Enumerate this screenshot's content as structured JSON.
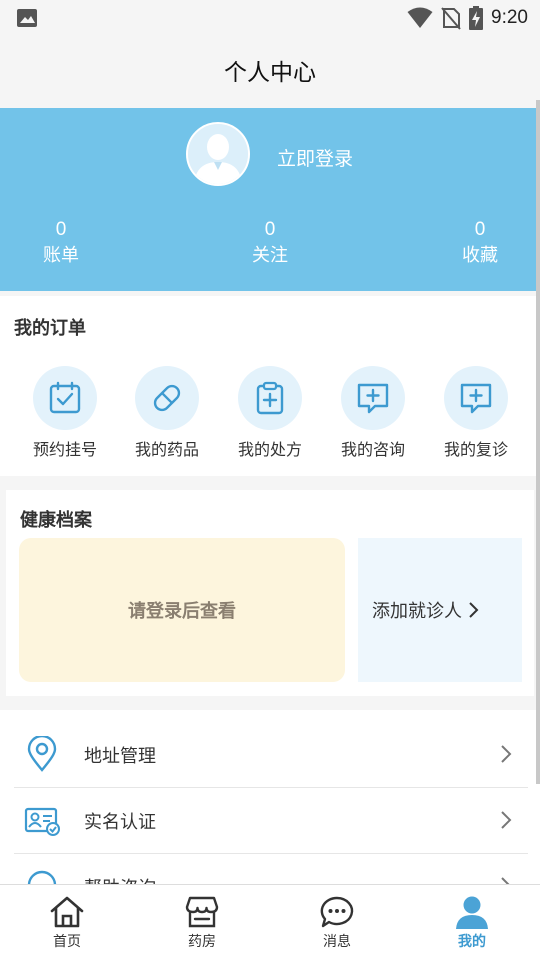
{
  "status_bar": {
    "time": "9:20",
    "icons": [
      "image-icon",
      "wifi-icon",
      "no-sim-icon",
      "battery-charging-icon"
    ]
  },
  "header": {
    "title": "个人中心"
  },
  "profile": {
    "login_label": "立即登录",
    "stats": [
      {
        "value": "0",
        "label": "账单"
      },
      {
        "value": "0",
        "label": "关注"
      },
      {
        "value": "0",
        "label": "收藏"
      }
    ],
    "colors": {
      "background": "#72c3e9"
    }
  },
  "orders": {
    "title": "我的订单",
    "items": [
      {
        "label": "预约挂号",
        "icon": "calendar-check-icon"
      },
      {
        "label": "我的药品",
        "icon": "pill-icon"
      },
      {
        "label": "我的处方",
        "icon": "clipboard-plus-icon"
      },
      {
        "label": "我的咨询",
        "icon": "chat-plus-icon"
      },
      {
        "label": "我的复诊",
        "icon": "chat-plus-icon"
      }
    ]
  },
  "health": {
    "title": "健康档案",
    "login_prompt": "请登录后查看",
    "add_patient": "添加就诊人"
  },
  "menu": {
    "items": [
      {
        "label": "地址管理",
        "icon": "location-pin-icon"
      },
      {
        "label": "实名认证",
        "icon": "id-card-icon"
      },
      {
        "label": "帮助咨询",
        "icon": "headset-icon"
      }
    ]
  },
  "tabbar": {
    "tabs": [
      {
        "label": "首页",
        "icon": "home-icon"
      },
      {
        "label": "药房",
        "icon": "store-icon"
      },
      {
        "label": "消息",
        "icon": "message-icon"
      },
      {
        "label": "我的",
        "icon": "user-icon",
        "active": true
      }
    ],
    "colors": {
      "active": "#3d9ad0"
    }
  }
}
